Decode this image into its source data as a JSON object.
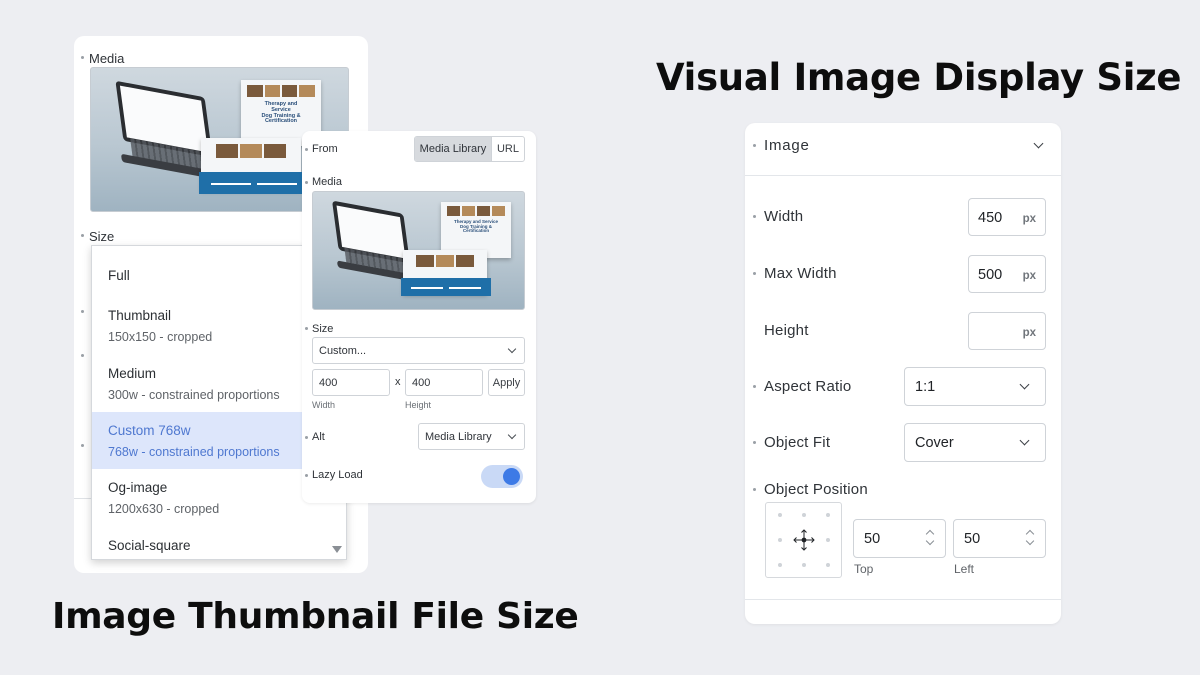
{
  "headlines": {
    "right": "Visual Image Display Size",
    "left": "Image Thumbnail File Size"
  },
  "left_panel": {
    "media_label": "Media",
    "size_label": "Size",
    "size_options": [
      {
        "title": "Full",
        "detail": ""
      },
      {
        "title": "Thumbnail",
        "detail": "150x150 - cropped"
      },
      {
        "title": "Medium",
        "detail": "300w - constrained proportions"
      },
      {
        "title": "Custom 768w",
        "detail": "768w - constrained proportions",
        "selected": true
      },
      {
        "title": "Og-image",
        "detail": "1200x630 - cropped"
      },
      {
        "title": "Social-square",
        "detail": ""
      }
    ]
  },
  "mock_site": {
    "heading_line1": "Therapy and Service",
    "heading_line2": "Dog Training &",
    "heading_line3": "Certification"
  },
  "middle_panel": {
    "from_label": "From",
    "source_options": [
      "Media Library",
      "URL"
    ],
    "source_selected": "Media Library",
    "media_label": "Media",
    "size_label": "Size",
    "size_value": "Custom...",
    "width_value": "400",
    "times": "x",
    "height_value": "400",
    "apply_label": "Apply",
    "width_caption": "Width",
    "height_caption": "Height",
    "alt_label": "Alt",
    "alt_value": "Media Library",
    "lazy_load_label": "Lazy Load",
    "lazy_load_on": true
  },
  "right_panel": {
    "section_title": "Image",
    "width": {
      "label": "Width",
      "value": "450",
      "unit": "px"
    },
    "max_width": {
      "label": "Max Width",
      "value": "500",
      "unit": "px"
    },
    "height": {
      "label": "Height",
      "value": "",
      "unit": "px"
    },
    "aspect_ratio": {
      "label": "Aspect Ratio",
      "value": "1:1"
    },
    "object_fit": {
      "label": "Object Fit",
      "value": "Cover"
    },
    "object_position": {
      "label": "Object Position",
      "top": {
        "value": "50",
        "caption": "Top"
      },
      "left": {
        "value": "50",
        "caption": "Left"
      }
    }
  }
}
